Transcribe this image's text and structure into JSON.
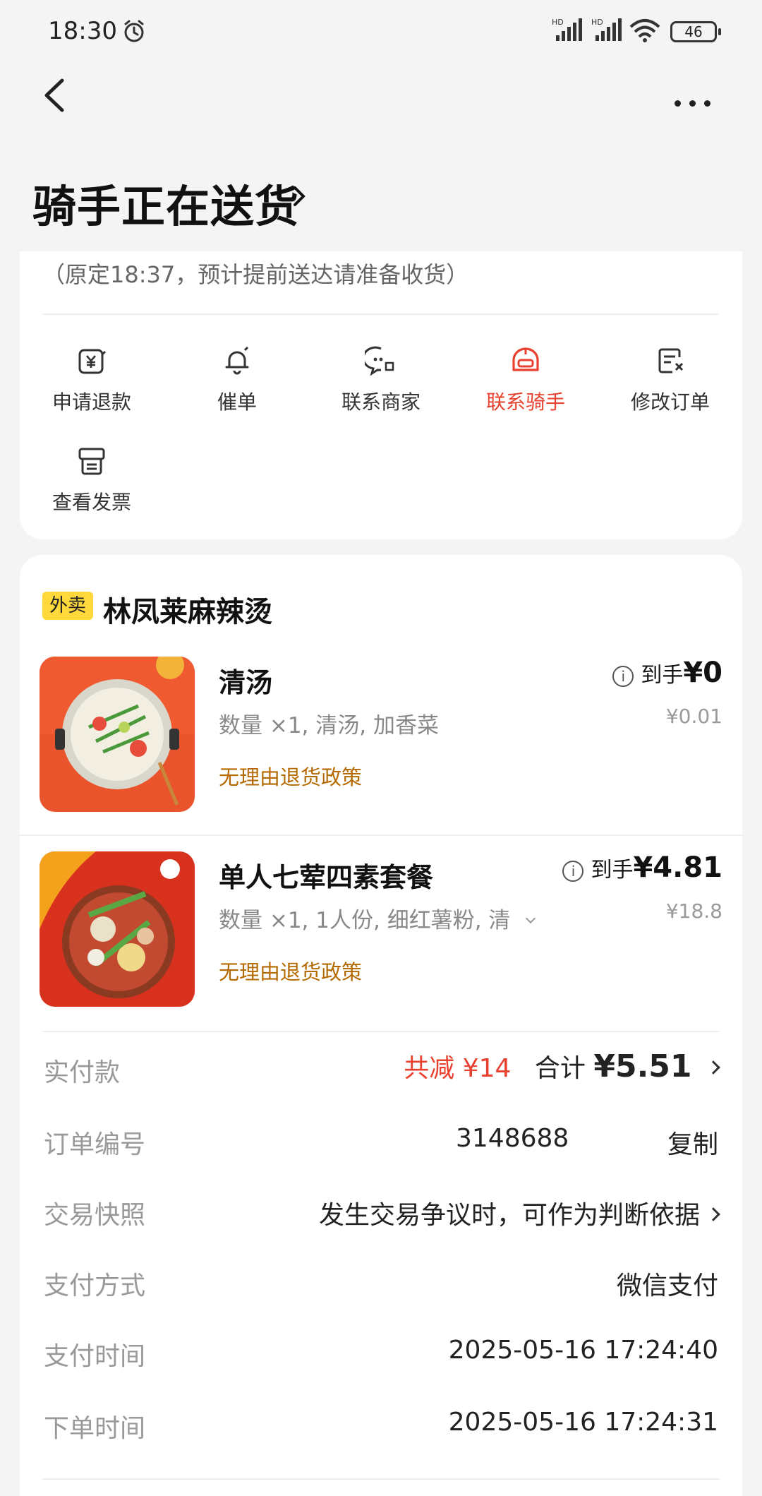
{
  "status_bar": {
    "time": "18:30",
    "battery": "46",
    "signal1": "HD",
    "signal2": "HD"
  },
  "header": {
    "title": "骑手正在送货"
  },
  "delivery": {
    "note": "（原定18:37，预计提前送达请准备收货）"
  },
  "actions": [
    {
      "label": "申请退款",
      "icon": "refund-icon"
    },
    {
      "label": "催单",
      "icon": "bell-icon"
    },
    {
      "label": "联系商家",
      "icon": "chat-icon"
    },
    {
      "label": "联系骑手",
      "icon": "rider-helmet-icon",
      "active": true
    },
    {
      "label": "修改订单",
      "icon": "edit-order-icon"
    },
    {
      "label": "查看发票",
      "icon": "invoice-icon"
    }
  ],
  "store": {
    "tag": "外卖",
    "name": "林凤莱麻辣烫"
  },
  "products": [
    {
      "name": "清汤",
      "meta": "数量 ×1, 清汤, 加香菜",
      "policy": "无理由退货政策",
      "price_prefix": "到手",
      "price": "¥0",
      "original": "¥0.01"
    },
    {
      "name": "单人七荤四素套餐",
      "meta": "数量 ×1, 1人份, 细红薯粉, 清",
      "policy": "无理由退货政策",
      "price_prefix": "到手",
      "price": "¥4.81",
      "original": "¥18.8"
    }
  ],
  "summary": {
    "paid_label": "实付款",
    "discount": "共减 ¥14",
    "total_label": "合计",
    "total": "¥5.51",
    "order_no_label": "订单编号",
    "order_no": "3148688",
    "copy": "复制",
    "snapshot_label": "交易快照",
    "snapshot": "发生交易争议时，可作为判断依据",
    "pay_method_label": "支付方式",
    "pay_method": "微信支付",
    "pay_time_label": "支付时间",
    "pay_time": "2025-05-16 17:24:40",
    "order_time_label": "下单时间",
    "order_time": "2025-05-16 17:24:31"
  },
  "colors": {
    "accent": "#e8412f",
    "policy": "#b46a00",
    "tag": "#ffd83b"
  }
}
